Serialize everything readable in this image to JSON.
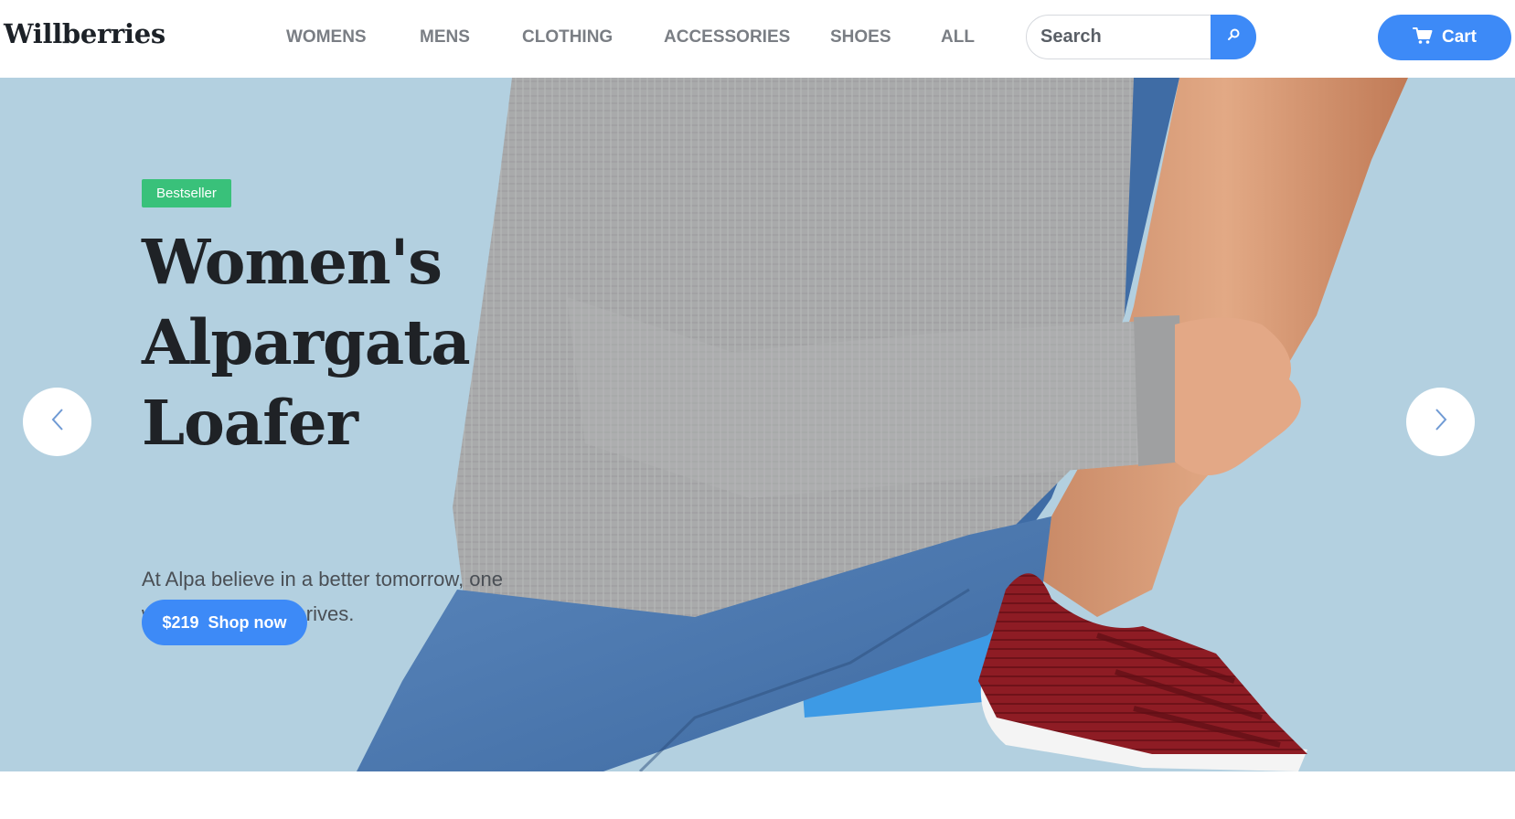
{
  "header": {
    "logo": "Willberries",
    "nav": [
      {
        "label": "WOMENS"
      },
      {
        "label": "MENS"
      },
      {
        "label": "CLOTHING"
      },
      {
        "label": "ACCESSORIES"
      },
      {
        "label": "SHOES"
      },
      {
        "label": "ALL"
      }
    ],
    "search": {
      "placeholder": "Search",
      "icon": "search-icon"
    },
    "cart": {
      "label": "Cart",
      "icon": "cart-icon"
    }
  },
  "hero": {
    "badge": "Bestseller",
    "title_lines": [
      "Women's",
      "Alpargata",
      "Loafer"
    ],
    "description": "At Alpa believe in a better tomorrow, one where humanity thrives.",
    "price": "$219",
    "cta": "Shop now",
    "prev_icon": "chevron-left-icon",
    "next_icon": "chevron-right-icon"
  },
  "colors": {
    "accent": "#3d8af7",
    "badge": "#39c17a",
    "hero_background": "#b3d0e0",
    "text_dark": "#1f2226"
  }
}
